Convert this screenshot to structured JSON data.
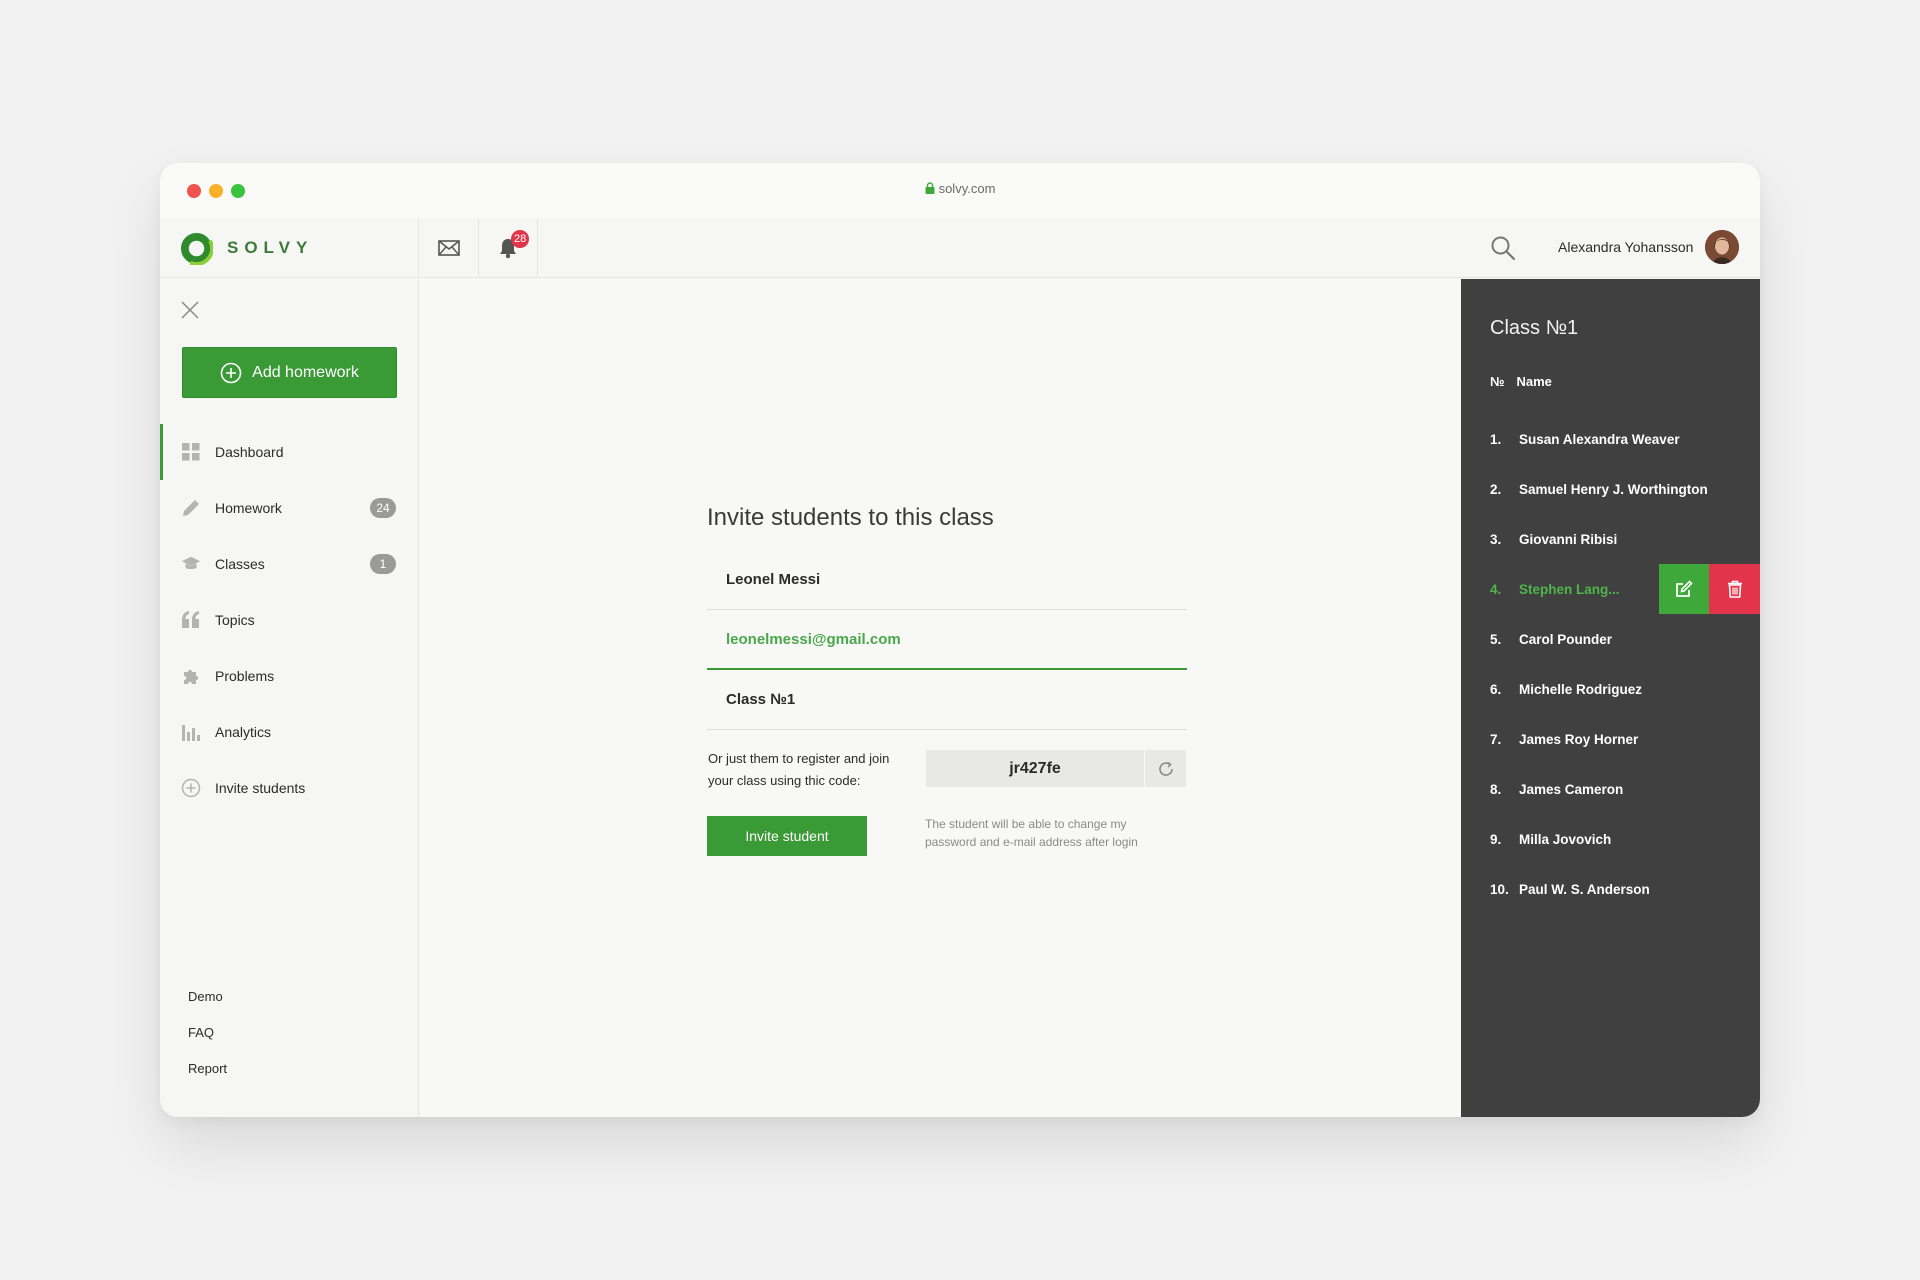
{
  "browser": {
    "url": "solvy.com"
  },
  "header": {
    "logo_text": "SOLVY",
    "notifications_count": "28",
    "user_name": "Alexandra Yohansson"
  },
  "sidebar": {
    "add_homework_label": "Add homework",
    "items": [
      {
        "label": "Dashboard",
        "icon": "grid-icon",
        "badge": ""
      },
      {
        "label": "Homework",
        "icon": "pencil-icon",
        "badge": "24"
      },
      {
        "label": "Classes",
        "icon": "graduation-cap-icon",
        "badge": "1"
      },
      {
        "label": "Topics",
        "icon": "quote-icon",
        "badge": ""
      },
      {
        "label": "Problems",
        "icon": "puzzle-icon",
        "badge": ""
      },
      {
        "label": "Analytics",
        "icon": "bar-chart-icon",
        "badge": ""
      },
      {
        "label": "Invite students",
        "icon": "plus-circle-icon",
        "badge": ""
      }
    ],
    "footer_links": [
      "Demo",
      "FAQ",
      "Report"
    ]
  },
  "form": {
    "title": "Invite students to this class",
    "name_value": "Leonel Messi",
    "email_value": "leonelmessi@gmail.com",
    "class_value": "Class №1",
    "code_hint": "Or just them to register and join your class using thic code:",
    "code": "jr427fe",
    "invite_label": "Invite student",
    "invite_note": "The student will be able to change my password and e-mail address after login"
  },
  "panel": {
    "title": "Class №1",
    "col_num": "№",
    "col_name": "Name",
    "students": [
      {
        "num": "1.",
        "name": "Susan Alexandra Weaver"
      },
      {
        "num": "2.",
        "name": "Samuel Henry J. Worthington"
      },
      {
        "num": "3.",
        "name": "Giovanni Ribisi"
      },
      {
        "num": "4.",
        "name": "Stephen Lang..."
      },
      {
        "num": "5.",
        "name": "Carol Pounder"
      },
      {
        "num": "6.",
        "name": "Michelle Rodriguez"
      },
      {
        "num": "7.",
        "name": "James Roy Horner"
      },
      {
        "num": "8.",
        "name": "James Cameron"
      },
      {
        "num": "9.",
        "name": "Milla Jovovich"
      },
      {
        "num": "10.",
        "name": "Paul W. S. Anderson"
      }
    ]
  },
  "colors": {
    "accent_green": "#3a9a35",
    "danger_red": "#e2344a",
    "panel_bg": "#404040"
  }
}
